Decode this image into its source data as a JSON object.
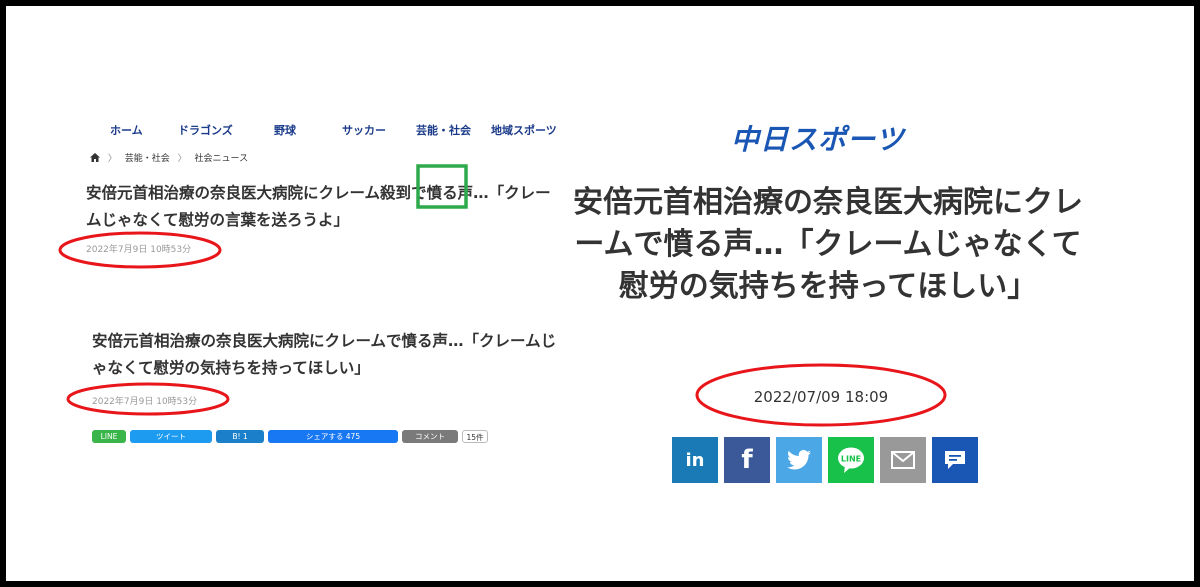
{
  "nav": {
    "items": [
      "ホーム",
      "ドラゴンズ",
      "野球",
      "サッカー",
      "芸能・社会",
      "地域スポーツ"
    ]
  },
  "breadcrumb": {
    "items": [
      "芸能・社会",
      "社会ニュース"
    ]
  },
  "left_article_1": {
    "headline_before": "安倍元首相治療の奈良医大病院にクレーム",
    "headline_highlight": "殺到",
    "headline_after": "で憤る声…「クレームじゃなくて慰労の言葉を送ろうよ」",
    "date": "2022年7月9日 10時53分"
  },
  "left_article_2": {
    "headline": "安倍元首相治療の奈良医大病院にクレームで憤る声…「クレームじゃなくて慰労の気持ちを持ってほしい」",
    "date": "2022年7月9日 10時53分"
  },
  "share_bar": {
    "line": "LINE",
    "tweet": "ツイート",
    "hatena": "B! 1",
    "facebook": "シェアする 475",
    "comment": "コメント",
    "count": "15件"
  },
  "right_article": {
    "logo": "中日スポーツ",
    "headline": "安倍元首相治療の奈良医大病院にクレームで憤る声…「クレームじゃなくて慰労の気持ちを持ってほしい」",
    "date": "2022/07/09 18:09",
    "share_icons": [
      "linkedin-icon",
      "facebook-icon",
      "twitter-icon",
      "line-icon",
      "mail-icon",
      "comment-icon"
    ]
  },
  "colors": {
    "nav_text": "#1b3b8a",
    "logo_blue": "#1a56b3",
    "annotation_red": "#e8161b",
    "annotation_green": "#2eaa4a"
  }
}
